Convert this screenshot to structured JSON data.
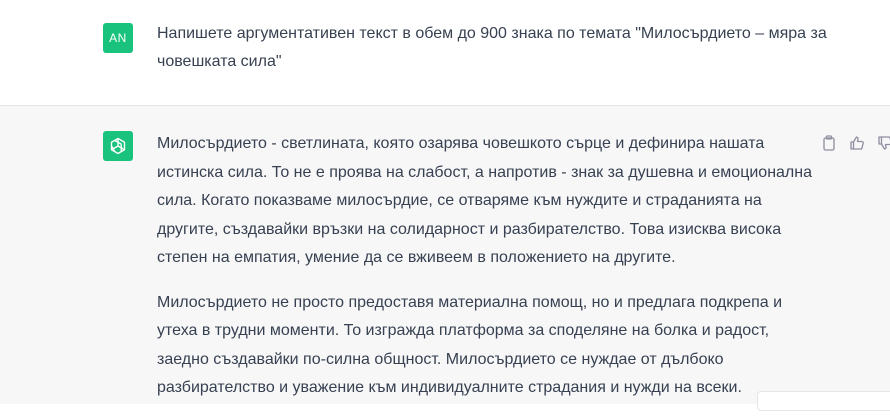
{
  "user_message": {
    "avatar_initials": "AN",
    "text": "Напишете аргументативен текст в обем до 900 знака по темата  \"Милосърдието – мяра за човешката сила\""
  },
  "assistant_message": {
    "paragraphs": [
      "Милосърдието - светлината, която озарява човешкото сърце и дефинира нашата истинска сила. То не е проява на слабост, а напротив - знак за душевна и емоционална сила. Когато показваме милосърдие, се отваряме към нуждите и страданията на другите, създавайки връзки на солидарност и разбирателство. Това изисква висока степен на емпатия, умение да се вживеем в положението на другите.",
      "Милосърдието не просто предоставя материална помощ, но и предлага подкрепа и утеха в трудни моменти. То изгражда платформа за споделяне на болка и радост, заедно създавайки по-силна общност. Милосърдието се нуждае от дълбоко разбирателство и уважение към индивидуалните страдания и нужди на всеки."
    ]
  },
  "icons": {
    "user_avatar": "user-avatar",
    "assistant_avatar": "openai-logo-icon",
    "copy": "clipboard-icon",
    "like": "thumbs-up-icon",
    "dislike": "thumbs-down-icon"
  },
  "colors": {
    "avatar_green": "#19c37d",
    "assistant_bg": "#f7f7f8",
    "text": "#374151",
    "icon_gray": "#8e8ea0"
  }
}
